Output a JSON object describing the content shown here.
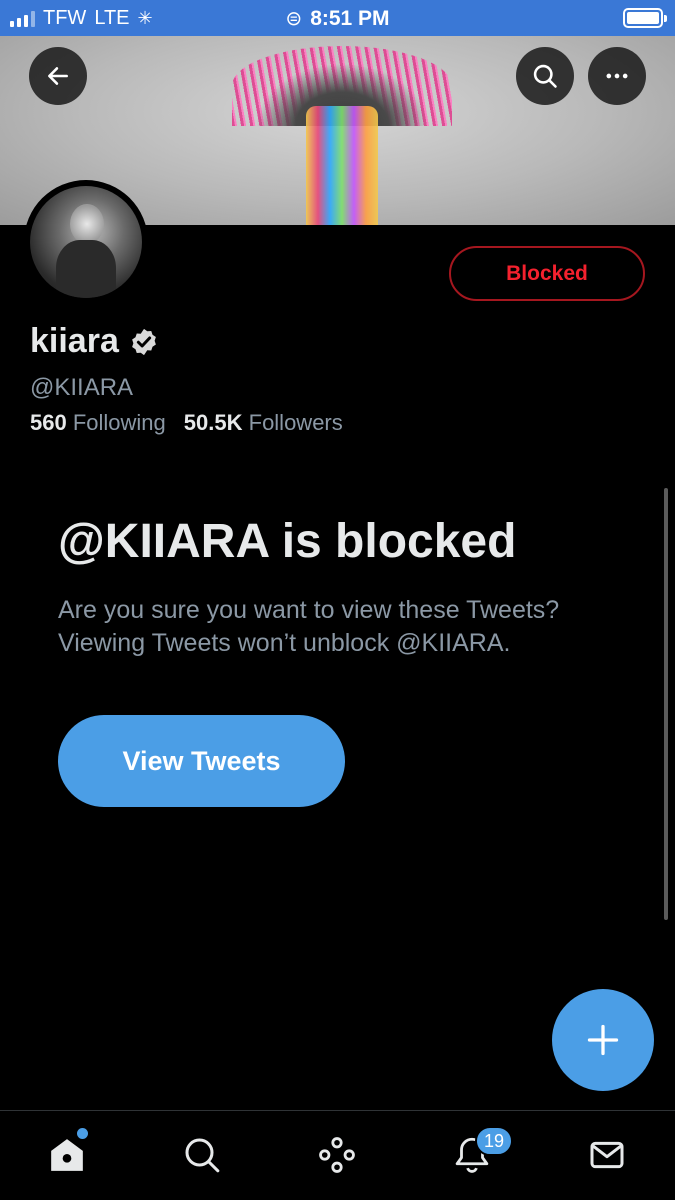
{
  "status_bar": {
    "carrier": "TFW",
    "network": "LTE",
    "time": "8:51 PM"
  },
  "profile": {
    "name": "kiiara",
    "handle": "@KIIARA",
    "following_count": "560",
    "following_label": "Following",
    "followers_count": "50.5K",
    "followers_label": "Followers",
    "verified": true
  },
  "actions": {
    "blocked_label": "Blocked",
    "view_tweets_label": "View Tweets"
  },
  "block_notice": {
    "title": "@KIIARA is blocked",
    "description": "Are you sure you want to view these Tweets? Viewing Tweets won’t unblock @KIIARA."
  },
  "tab_bar": {
    "notifications_badge": "19"
  },
  "colors": {
    "accent": "#4b9ee6",
    "blocked_red": "#f4212e",
    "status_bar": "#3a78d6",
    "background": "#000000",
    "secondary_text": "#8b98a5"
  },
  "icons": [
    "back-arrow-icon",
    "search-icon",
    "more-icon",
    "verified-icon",
    "compose-plus-icon",
    "home-icon",
    "search-tab-icon",
    "spaces-icon",
    "bell-icon",
    "mail-icon"
  ]
}
